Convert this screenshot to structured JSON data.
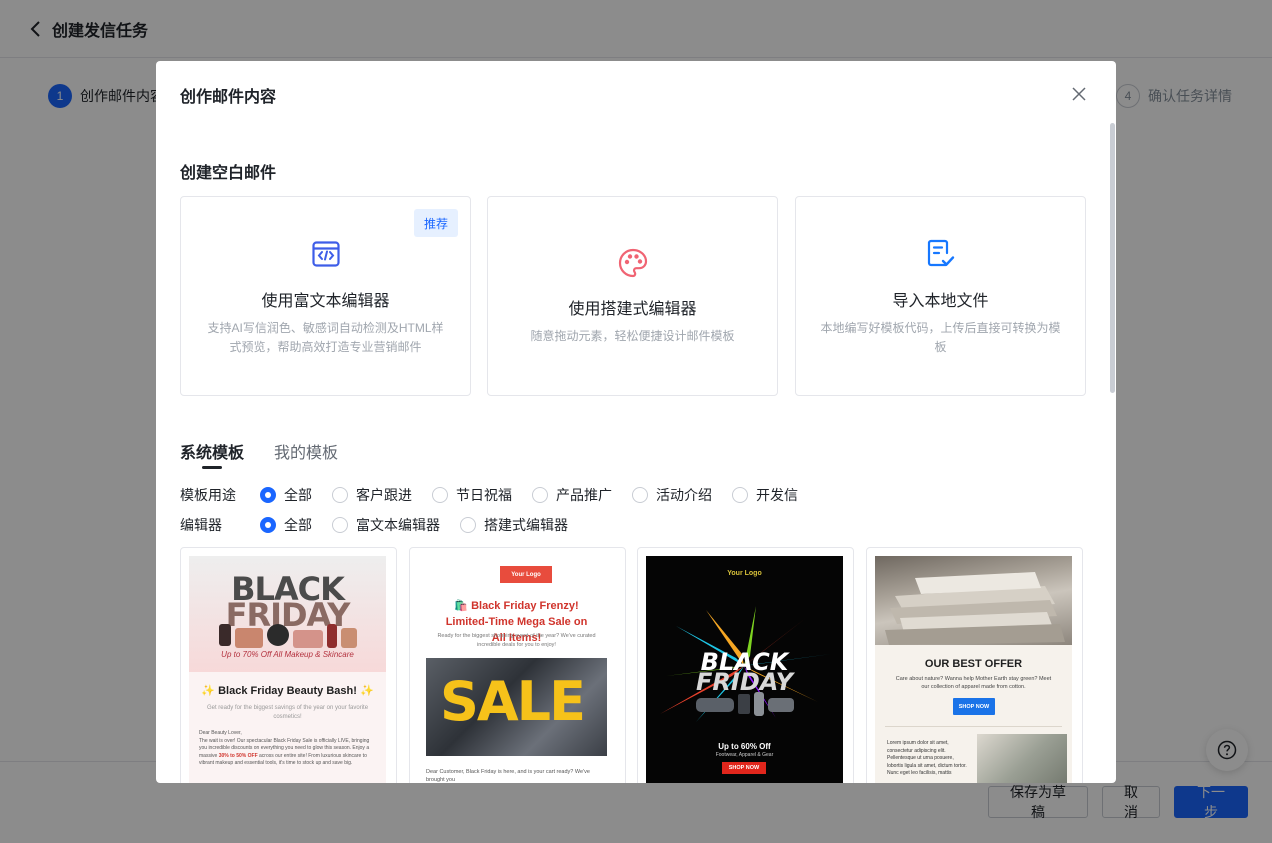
{
  "page": {
    "title": "创建发信任务",
    "steps": [
      {
        "num": "1",
        "label": "创作邮件内容"
      },
      {
        "num": "4",
        "label": "确认任务详情"
      }
    ],
    "footer": {
      "save_draft": "保存为草稿",
      "cancel": "取消",
      "next": "下一步"
    },
    "help_icon": "?"
  },
  "modal": {
    "title": "创作邮件内容",
    "close_icon": "×",
    "blank_section_title": "创建空白邮件",
    "cards": [
      {
        "icon": "code-icon",
        "badge": "推荐",
        "title": "使用富文本编辑器",
        "desc": "支持AI写信润色、敏感词自动检测及HTML样式预览，帮助高效打造专业营销邮件"
      },
      {
        "icon": "palette-icon",
        "title": "使用搭建式编辑器",
        "desc": "随意拖动元素，轻松便捷设计邮件模板"
      },
      {
        "icon": "file-import-icon",
        "title": "导入本地文件",
        "desc": "本地编写好模板代码，上传后直接可转换为模板"
      }
    ],
    "tabs": [
      {
        "label": "系统模板",
        "active": true
      },
      {
        "label": "我的模板",
        "active": false
      }
    ],
    "filters": {
      "usage": {
        "label": "模板用途",
        "options": [
          "全部",
          "客户跟进",
          "节日祝福",
          "产品推广",
          "活动介绍",
          "开发信"
        ],
        "selected": "全部"
      },
      "editor": {
        "label": "编辑器",
        "options": [
          "全部",
          "富文本编辑器",
          "搭建式编辑器"
        ],
        "selected": "全部"
      }
    },
    "templates": [
      {
        "hero_line1": "BLACK",
        "hero_line2": "FRIDAY",
        "tagline": "Up to 70% Off All Makeup & Skincare",
        "heading": "✨ Black Friday Beauty Bash! ✨",
        "subheading": "Get ready for the biggest savings of the year on your favorite cosmetics!",
        "greeting": "Dear Beauty Lover,",
        "body_1": "The wait is over! Our spectacular Black Friday Sale is officially LIVE, bringing you incredible discounts on everything you need to glow this season. Enjoy a massive ",
        "body_highlight": "30% to 50% OFF",
        "body_2": " across our entire site! From luxurious skincare to vibrant makeup and essential tools, it's time to stock up and save big."
      },
      {
        "logo": "Your Logo",
        "title": "🛍️ Black Friday Frenzy! Limited-Time Mega Sale on All Items!",
        "subtitle": "Ready for the biggest shopping event of the year? We've curated incredible deals for you to enjoy!",
        "image_word": "SALE",
        "body": "Dear Customer, Black Friday is here, and is your cart ready? We've brought you"
      },
      {
        "logo": "Your Logo",
        "line1": "BLACK",
        "line2": "FRIDAY",
        "offer": "Up to 60% Off",
        "category": "Footwear, Apparel & Gear",
        "cta": "SHOP NOW"
      },
      {
        "title": "OUR BEST OFFER",
        "subtitle": "Care about nature? Wanna help Mother Earth stay green? Meet our collection of apparel made from cotton.",
        "cta": "SHOP NOW",
        "body": "Lorem ipsum dolor sit amet, consectetur adipiscing elit. Pellentesque ut urna posuere, lobortis ligula sit amet, dictum tortor. Nunc eget leo facilisis, mattis"
      }
    ]
  },
  "colors": {
    "primary": "#1a66ff",
    "accent_red": "#d0342c",
    "badge_bg": "#e6f0ff"
  }
}
